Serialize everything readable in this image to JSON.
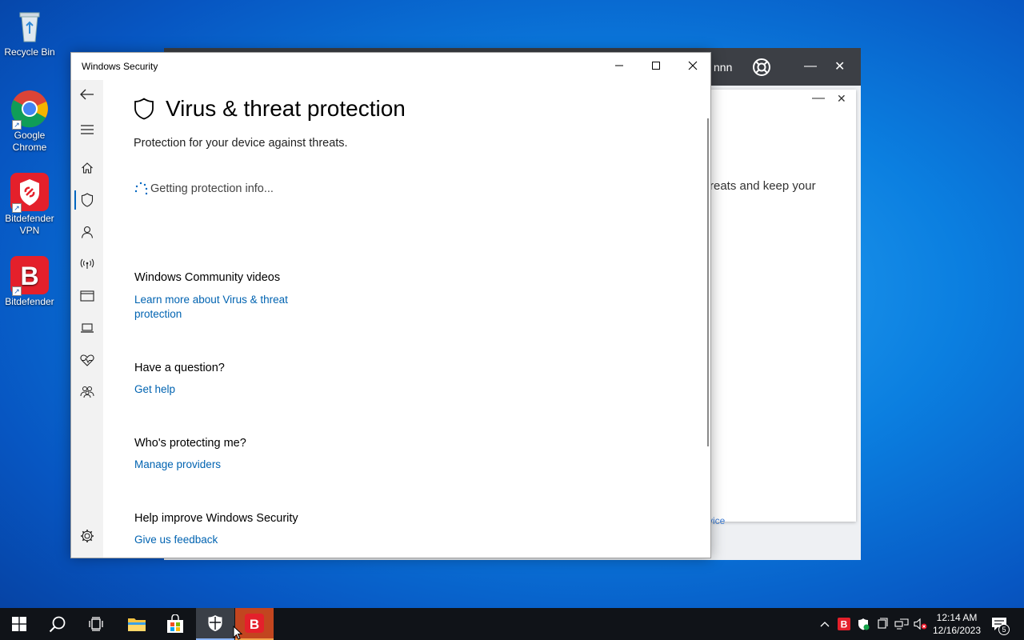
{
  "desktop": {
    "icons": [
      {
        "label": "Recycle Bin"
      },
      {
        "label": "Google Chrome"
      },
      {
        "label": "Bitdefender VPN"
      },
      {
        "label": "Bitdefender"
      }
    ]
  },
  "background_window": {
    "user_label": "nnn",
    "body_text": "reats and keep your",
    "link_text": "vice"
  },
  "window": {
    "title": "Windows Security",
    "controls": {
      "minimize": "—",
      "maximize": "☐",
      "close": "✕"
    }
  },
  "page": {
    "heading": "Virus & threat protection",
    "subtitle": "Protection for your device against threats.",
    "loading_text": "Getting protection info...",
    "sections": [
      {
        "title": "Windows Community videos",
        "link": "Learn more about Virus & threat protection"
      },
      {
        "title": "Have a question?",
        "link": "Get help"
      },
      {
        "title": "Who's protecting me?",
        "link": "Manage providers"
      },
      {
        "title": "Help improve Windows Security",
        "link": "Give us feedback"
      }
    ]
  },
  "nav": {
    "items": [
      {
        "icon": "back-arrow-icon"
      },
      {
        "icon": "hamburger-menu-icon"
      },
      {
        "icon": "home-icon"
      },
      {
        "icon": "shield-icon",
        "active": true
      },
      {
        "icon": "account-icon"
      },
      {
        "icon": "network-icon"
      },
      {
        "icon": "app-browser-icon"
      },
      {
        "icon": "device-security-icon"
      },
      {
        "icon": "device-health-icon"
      },
      {
        "icon": "family-icon"
      },
      {
        "icon": "settings-icon"
      }
    ]
  },
  "taskbar": {
    "clock_time": "12:14 AM",
    "clock_date": "12/16/2023",
    "notification_count": "5"
  },
  "colors": {
    "accent": "#0067c0",
    "link": "#0063b1",
    "bitdefender_red": "#e4202b",
    "taskbar": "#101318"
  }
}
